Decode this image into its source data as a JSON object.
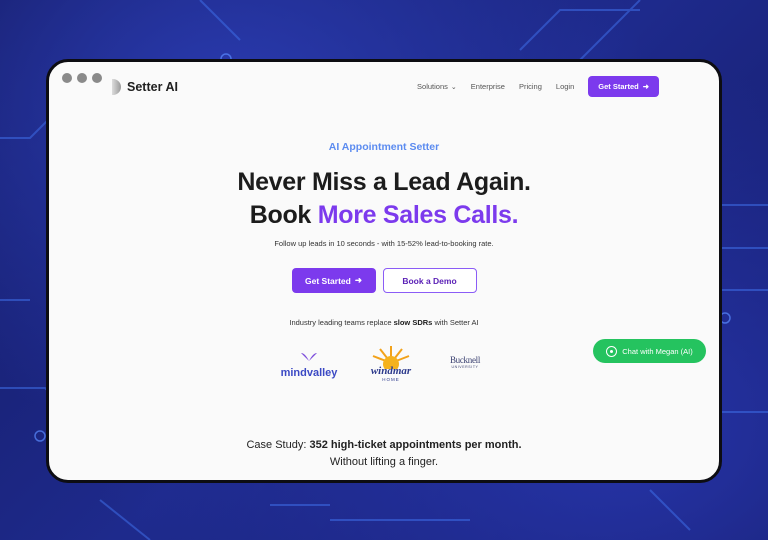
{
  "window": {
    "dots": [
      "dot",
      "dot",
      "dot"
    ]
  },
  "header": {
    "brand": "Setter AI",
    "nav": [
      {
        "label": "Solutions",
        "has_dropdown": true
      },
      {
        "label": "Enterprise"
      },
      {
        "label": "Pricing"
      },
      {
        "label": "Login"
      }
    ],
    "cta": "Get Started",
    "cta_icon": "arrow-right-icon"
  },
  "hero": {
    "eyebrow": "AI Appointment Setter",
    "headline_line1": "Never Miss a Lead Again.",
    "headline_line2_prefix": "Book",
    "headline_line2_accent": "More Sales Calls.",
    "subheadline": "Follow up leads in 10 seconds - with 15-52% lead-to-booking rate.",
    "primary_button": "Get Started",
    "secondary_button": "Book a Demo"
  },
  "trust": {
    "text_prefix": "Industry leading teams replace",
    "text_bold": "slow SDRs",
    "text_suffix": "with Setter AI",
    "logos": [
      {
        "name": "mindvalley",
        "icon": "mindvalley-logo-icon"
      },
      {
        "name": "windmar",
        "sub": "HOME",
        "icon": "windmar-sun-icon"
      },
      {
        "name": "Bucknell",
        "sub": "UNIVERSITY",
        "icon": "bucknell-logo-icon"
      }
    ]
  },
  "case_study": {
    "prefix": "Case Study:",
    "bold": "352 high-ticket appointments per month.",
    "line2": "Without lifting a finger."
  },
  "chat_widget": {
    "label": "Chat with Megan (AI)",
    "icon": "whatsapp-icon"
  },
  "colors": {
    "accent": "#7c3aed",
    "eyebrow": "#5b8bf0",
    "chat": "#25c35f",
    "background": "#1b1f6e"
  }
}
